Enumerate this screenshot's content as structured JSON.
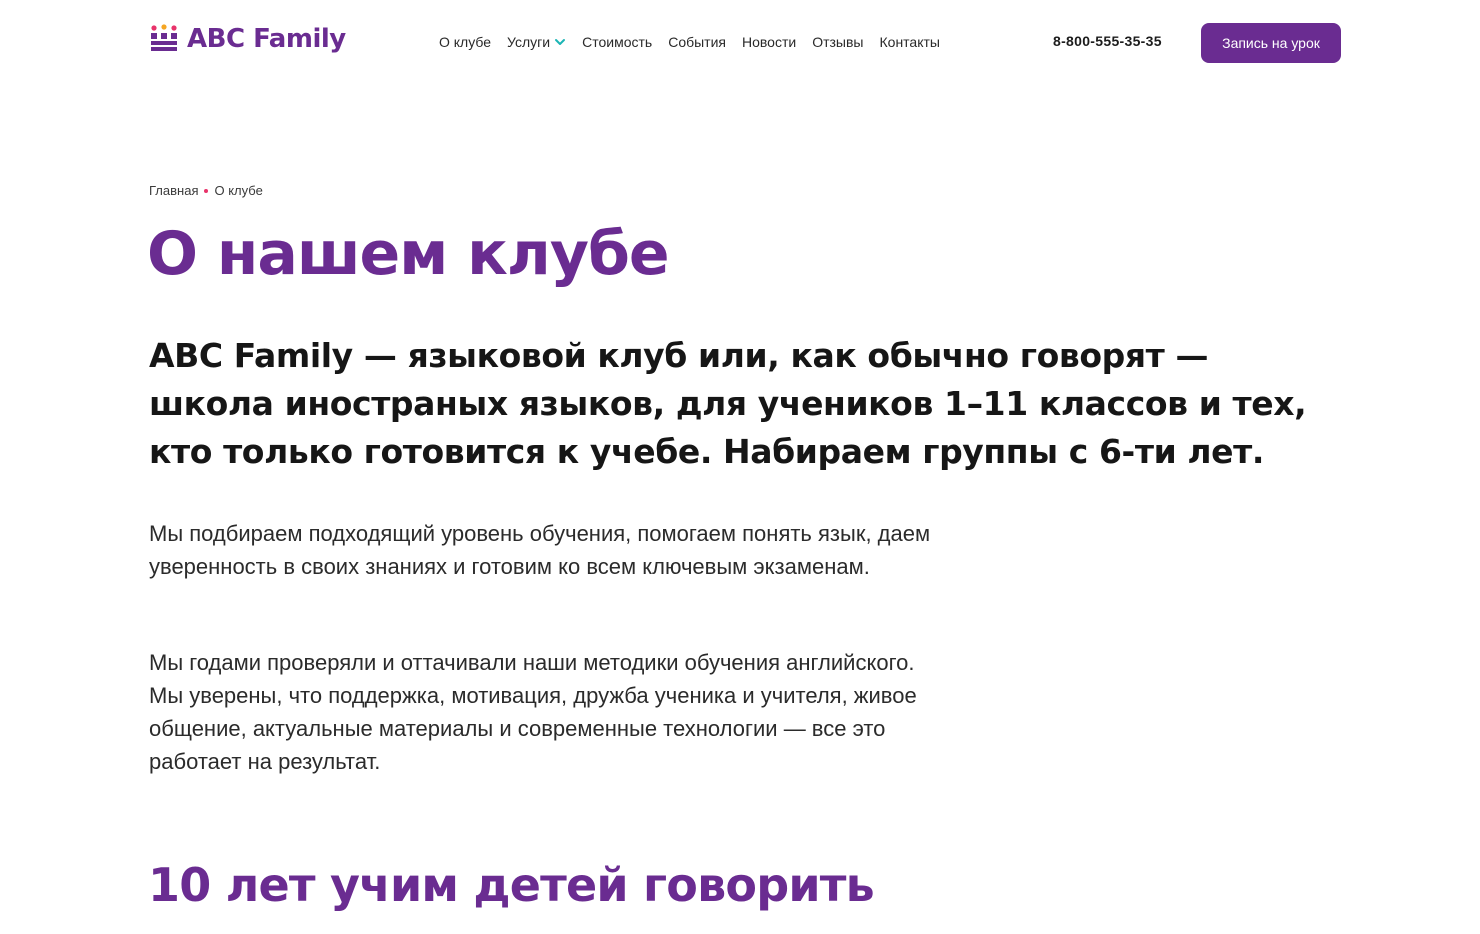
{
  "header": {
    "logo_text": "ABC Family",
    "logo_icon": "crown-blocks-icon",
    "nav": [
      {
        "label": "О клубе"
      },
      {
        "label": "Услуги",
        "has_dropdown": true
      },
      {
        "label": "Стоимость"
      },
      {
        "label": "События"
      },
      {
        "label": "Новости"
      },
      {
        "label": "Отзывы"
      },
      {
        "label": "Контакты"
      }
    ],
    "phone": "8-800-555-35-35",
    "cta_label": "Запись на урок"
  },
  "breadcrumb": {
    "home": "Главная",
    "current": "О клубе"
  },
  "page": {
    "title": "О нашем клубе",
    "lead": "ABC Family — языковой клуб или, как обычно говорят — школа иностраных языков, для учеников 1–11 классов и тех, кто только готовится к учебе. Набираем группы с 6-ти лет.",
    "paragraphs": [
      "Мы подбираем подходящий уровень обучения, помогаем понять язык, даем уверенность в своих знаниях и готовим ко всем ключевым экзаменам.",
      "Мы годами проверяли и оттачивали наши методики обучения английского. Мы уверены, что поддержка, мотивация, дружба ученика и учителя, живое общение, актуальные материалы и современные технологии — все это работает на результат."
    ],
    "section_title": "10 лет учим детей говорить"
  },
  "colors": {
    "brand_purple": "#6a2c91",
    "accent_teal": "#1cb5b5",
    "breadcrumb_dot": "#e8336a",
    "text": "#1c1c1c"
  }
}
